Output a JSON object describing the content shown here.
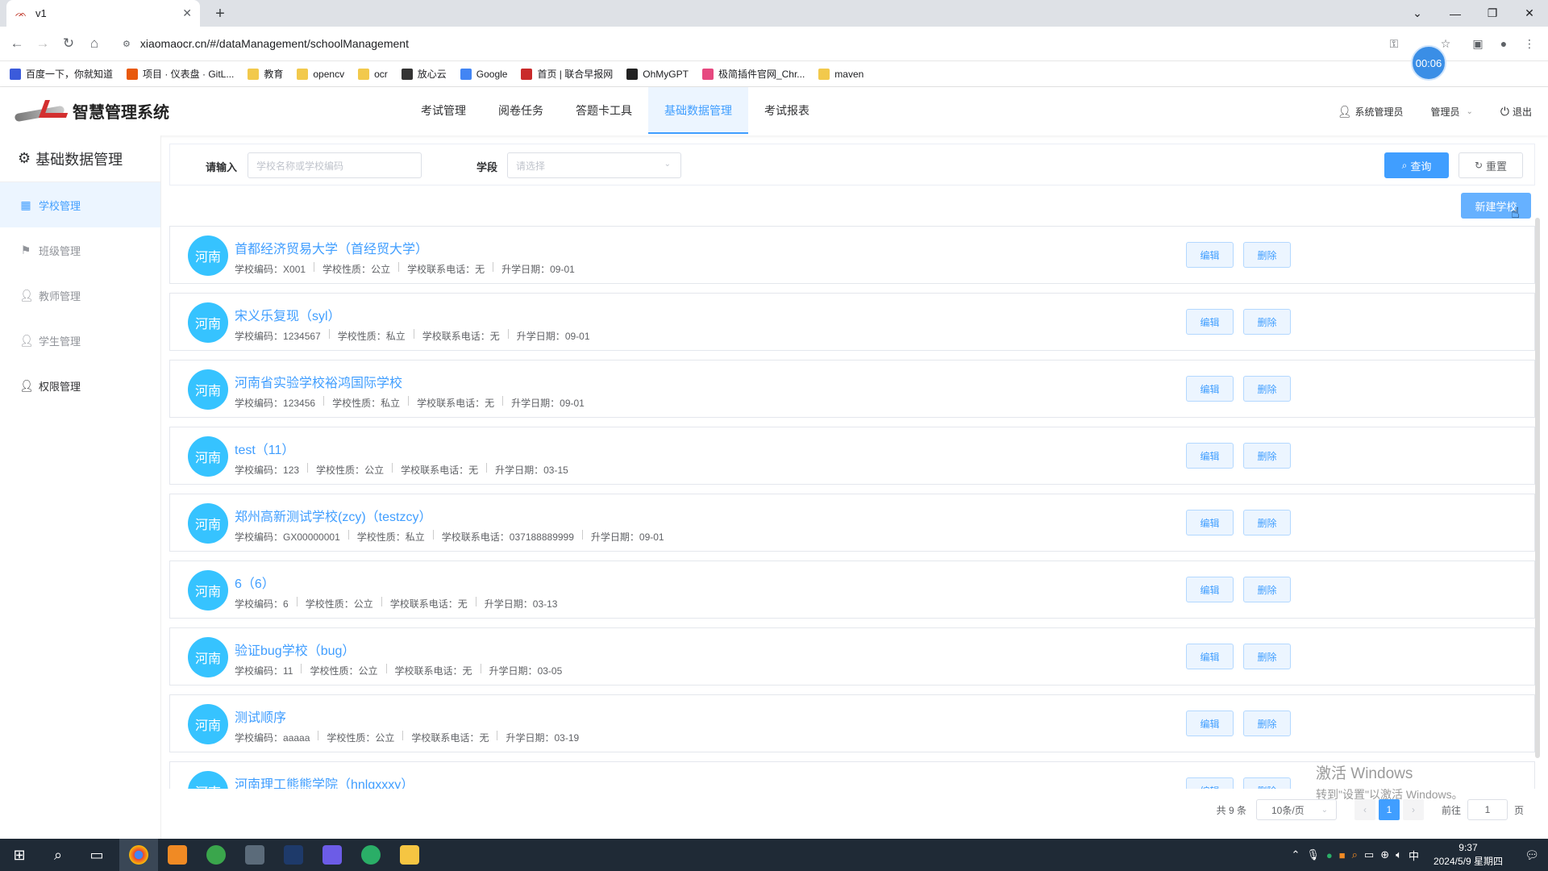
{
  "browser": {
    "tab_title": "v1",
    "url": "xiaomaocr.cn/#/dataManagement/schoolManagement",
    "timer": "00:06",
    "bookmarks": [
      {
        "label": "百度一下，你就知道",
        "color": "#3b5bdb"
      },
      {
        "label": "项目 · 仪表盘 · GitL...",
        "color": "#e8590c"
      },
      {
        "label": "教育",
        "color": "#f2c94c"
      },
      {
        "label": "opencv",
        "color": "#f2c94c"
      },
      {
        "label": "ocr",
        "color": "#f2c94c"
      },
      {
        "label": "放心云",
        "color": "#333333"
      },
      {
        "label": "Google",
        "color": "#4285f4"
      },
      {
        "label": "首页 | 联合早报网",
        "color": "#c92a2a"
      },
      {
        "label": "OhMyGPT",
        "color": "#222222"
      },
      {
        "label": "极简插件官网_Chr...",
        "color": "#e64980"
      },
      {
        "label": "maven",
        "color": "#f2c94c"
      }
    ]
  },
  "header": {
    "logo_text": "智慧管理系统",
    "nav": [
      "考试管理",
      "阅卷任务",
      "答题卡工具",
      "基础数据管理",
      "考试报表"
    ],
    "active_nav": "基础数据管理",
    "user": "系统管理员",
    "role": "管理员",
    "logout": "退出"
  },
  "sidebar": {
    "title": "基础数据管理",
    "items": [
      {
        "label": "学校管理",
        "icon": "building-icon",
        "active": true
      },
      {
        "label": "班级管理",
        "icon": "flag-icon"
      },
      {
        "label": "教师管理",
        "icon": "user-icon"
      },
      {
        "label": "学生管理",
        "icon": "user-icon"
      },
      {
        "label": "权限管理",
        "icon": "user-icon"
      }
    ]
  },
  "filter": {
    "input_label": "请输入",
    "input_placeholder": "学校名称或学校编码",
    "stage_label": "学段",
    "stage_placeholder": "请选择",
    "query": "查询",
    "reset": "重置",
    "new_school": "新建学校"
  },
  "meta_labels": {
    "code": "学校编码：",
    "type": "学校性质：",
    "phone": "学校联系电话：",
    "date": "升学日期："
  },
  "row_buttons": {
    "edit": "编辑",
    "delete": "删除"
  },
  "schools": [
    {
      "region": "河南",
      "name": "首都经济贸易大学（首经贸大学）",
      "code": "X001",
      "type": "公立",
      "phone": "无",
      "date": "09-01"
    },
    {
      "region": "河南",
      "name": "宋义乐复现（syl）",
      "code": "1234567",
      "type": "私立",
      "phone": "无",
      "date": "09-01"
    },
    {
      "region": "河南",
      "name": "河南省实验学校裕鸿国际学校",
      "code": "123456",
      "type": "私立",
      "phone": "无",
      "date": "09-01"
    },
    {
      "region": "河南",
      "name": "test（11）",
      "code": "123",
      "type": "公立",
      "phone": "无",
      "date": "03-15"
    },
    {
      "region": "河南",
      "name": "郑州高新测试学校(zcy)（testzcy）",
      "code": "GX00000001",
      "type": "私立",
      "phone": "037188889999",
      "date": "09-01"
    },
    {
      "region": "河南",
      "name": "6（6）",
      "code": "6",
      "type": "公立",
      "phone": "无",
      "date": "03-13"
    },
    {
      "region": "河南",
      "name": "验证bug学校（bug）",
      "code": "11",
      "type": "公立",
      "phone": "无",
      "date": "03-05"
    },
    {
      "region": "河南",
      "name": "测试顺序",
      "code": "aaaaa",
      "type": "公立",
      "phone": "无",
      "date": "03-19"
    },
    {
      "region": "河南",
      "name": "河南理工熊熊学院（hnlgxxxy）",
      "code": "",
      "type": "",
      "phone": "",
      "date": ""
    }
  ],
  "pagination": {
    "total": "共 9 条",
    "page_size": "10条/页",
    "current": "1",
    "goto_label": "前往",
    "goto_value": "1",
    "page_suffix": "页"
  },
  "watermark": {
    "line1": "激活 Windows",
    "line2": "转到\"设置\"以激活 Windows。"
  },
  "taskbar": {
    "time": "9:37",
    "date": "2024/5/9 星期四",
    "ime": "中"
  }
}
